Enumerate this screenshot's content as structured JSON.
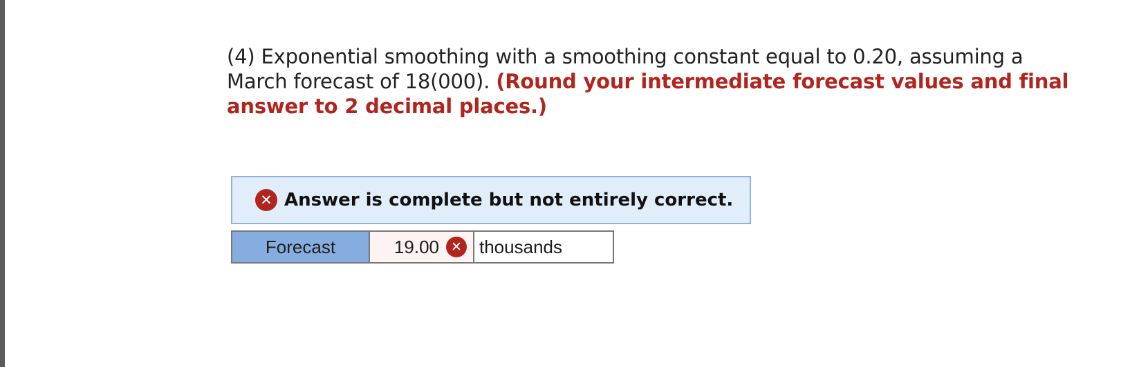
{
  "question": {
    "text": "(4) Exponential smoothing with a smoothing constant equal to 0.20, assuming a March forecast of 18(000).",
    "instruction": "(Round your intermediate forecast values and final answer to 2 decimal places.)"
  },
  "feedback": {
    "icon": "incorrect-x-icon",
    "message": "Answer is complete but not entirely correct.",
    "status_color": "#b0261f",
    "box_color": "#e1edf9"
  },
  "answer_row": {
    "label": "Forecast",
    "value": "19.00",
    "value_status_icon": "incorrect-x-icon",
    "unit": "thousands",
    "label_color": "#86ade0"
  }
}
